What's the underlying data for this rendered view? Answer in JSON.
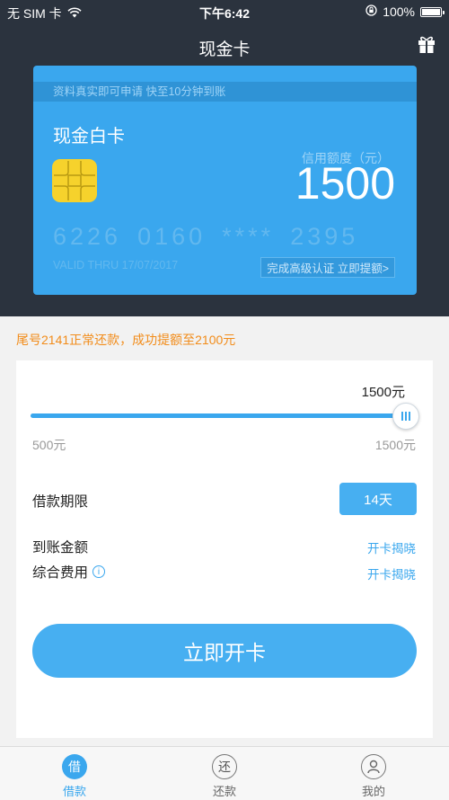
{
  "status_bar": {
    "carrier": "无 SIM 卡",
    "time": "下午6:42",
    "battery": "100%"
  },
  "nav": {
    "title": "现金卡"
  },
  "card": {
    "banner": "资料真实即可申请  快至10分钟到账",
    "name": "现金白卡",
    "limit_label": "信用额度（元）",
    "limit_value": "1500",
    "number_groups": [
      "6226",
      "0160",
      "****",
      "2395"
    ],
    "valid_thru": "VALID THRU 17/07/2017",
    "upgrade_link": "完成高级认证 立即提额>"
  },
  "notice": "尾号2141正常还款，成功提额至2100元",
  "slider": {
    "current_label": "1500元",
    "min_label": "500元",
    "max_label": "1500元",
    "fraction": 1.0
  },
  "loan": {
    "term_label": "借款期限",
    "term_value": "14天",
    "arrival_label": "到账金额",
    "arrival_value": "开卡揭晓",
    "fee_label": "综合费用",
    "fee_value": "开卡揭晓",
    "open_button": "立即开卡"
  },
  "tabbar": {
    "borrow": {
      "icon_char": "借",
      "label": "借款"
    },
    "repay": {
      "icon_char": "还",
      "label": "还款"
    },
    "mine": {
      "label": "我的"
    }
  },
  "colors": {
    "accent": "#3aa7ee",
    "header_bg": "#2b333e",
    "notice": "#f28c1a"
  }
}
